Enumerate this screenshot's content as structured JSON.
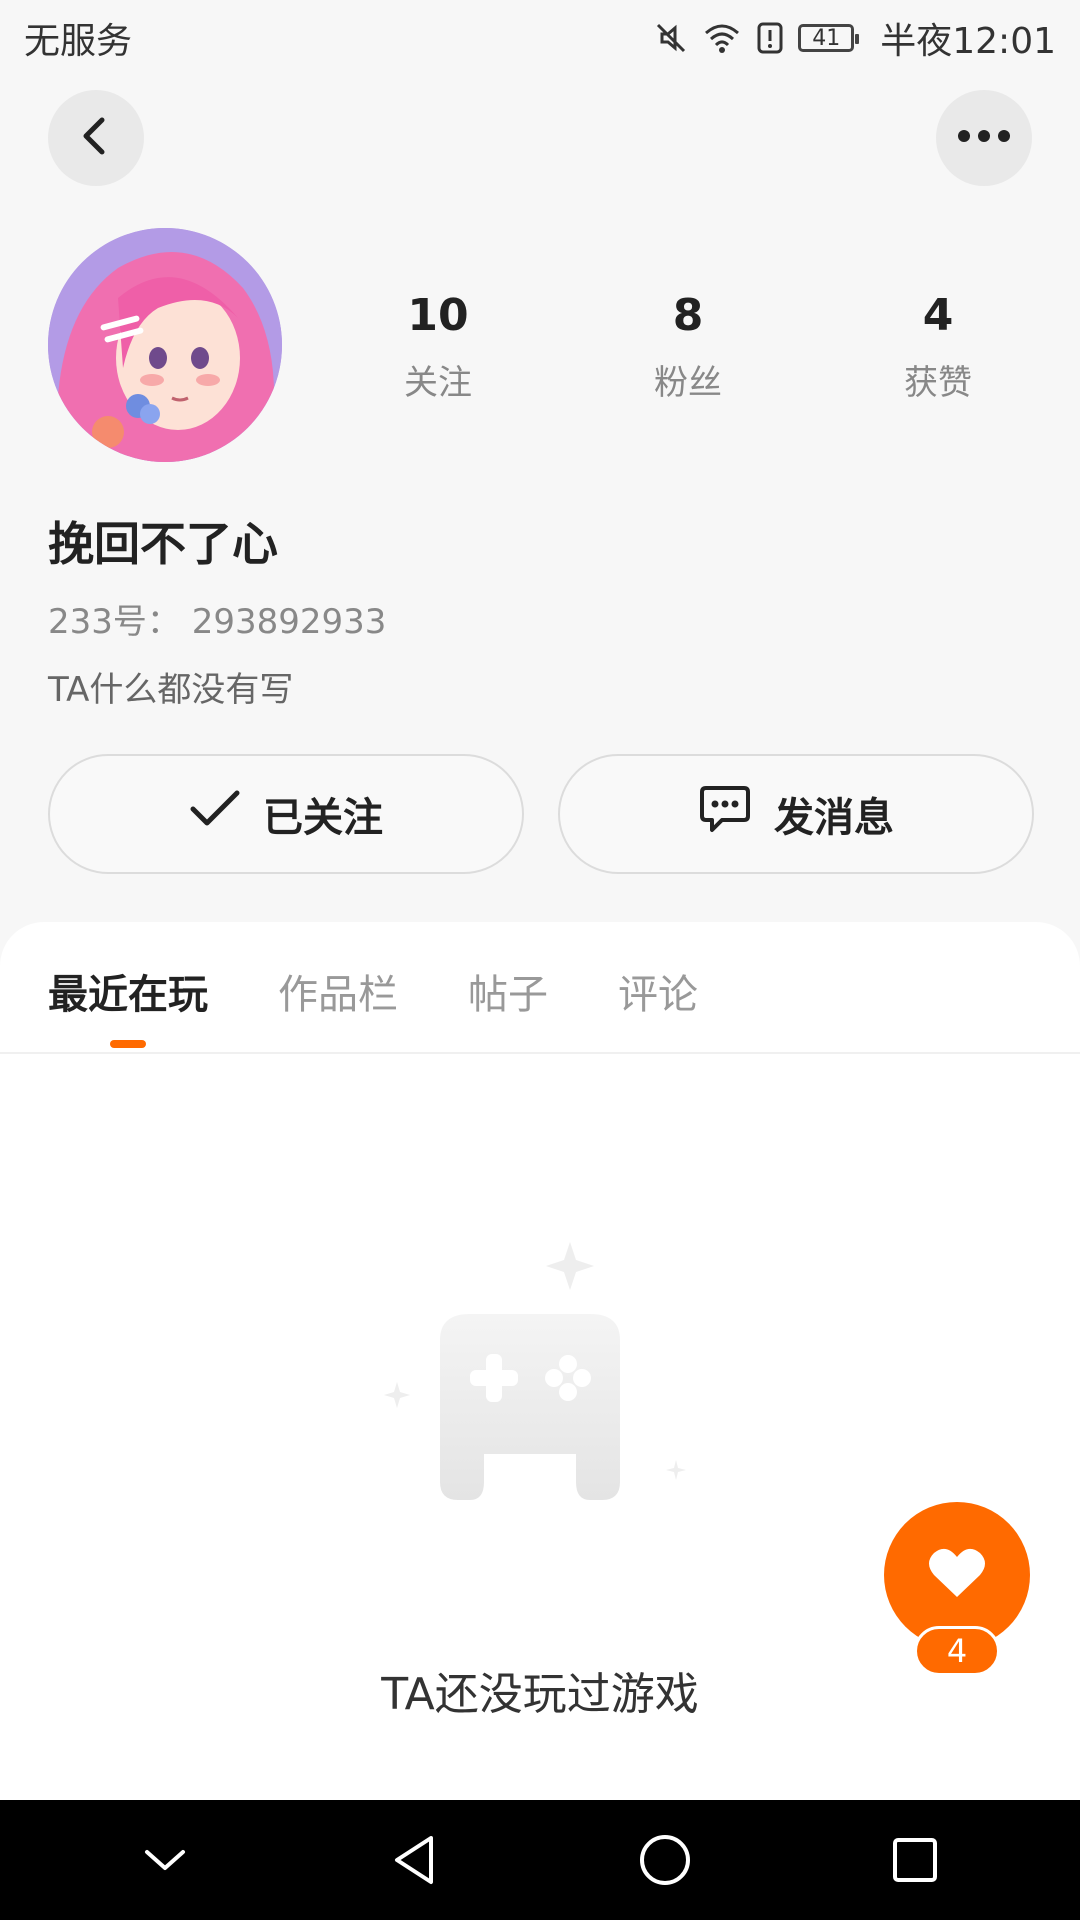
{
  "status_bar": {
    "carrier": "无服务",
    "battery": "41",
    "time": "半夜12:01",
    "icons": [
      "mute-icon",
      "wifi-icon",
      "alert-icon",
      "battery-icon"
    ]
  },
  "top_bar": {
    "back_icon": "chevron-left-icon",
    "more_icon": "more-horizontal-icon"
  },
  "profile": {
    "stats": [
      {
        "value": "10",
        "label": "关注"
      },
      {
        "value": "8",
        "label": "粉丝"
      },
      {
        "value": "4",
        "label": "获赞"
      }
    ],
    "username": "挽回不了心",
    "user_id": "233号： 293892933",
    "bio": "TA什么都没有写"
  },
  "actions": {
    "follow_label": "已关注",
    "message_label": "发消息"
  },
  "tabs": [
    {
      "label": "最近在玩",
      "active": true
    },
    {
      "label": "作品栏",
      "active": false
    },
    {
      "label": "帖子",
      "active": false
    },
    {
      "label": "评论",
      "active": false
    }
  ],
  "empty_state": {
    "text": "TA还没玩过游戏",
    "icon": "gamepad-icon"
  },
  "like_button": {
    "count": "4",
    "icon": "heart-icon"
  },
  "colors": {
    "accent": "#ff6a00",
    "background": "#f7f7f7",
    "text_primary": "#222222",
    "text_secondary": "#888888"
  },
  "nav_bar": {
    "icons": [
      "collapse-icon",
      "back-triangle-icon",
      "home-circle-icon",
      "recents-square-icon"
    ]
  }
}
